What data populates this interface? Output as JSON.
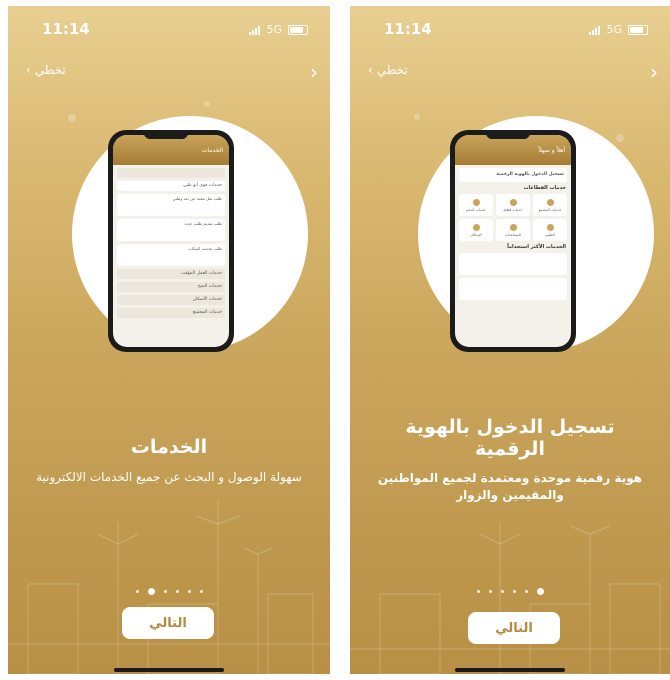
{
  "left": {
    "status": {
      "time": "11:14",
      "network": "5G"
    },
    "nav": {
      "skip": "تخطي",
      "skip_icon": "chevron-left-icon",
      "back_icon": "chevron-right-icon"
    },
    "mock_phone": {
      "header": "الخدمات",
      "rows": [
        "خدمات قوى أبو ظبي",
        "خدمات العمل المؤقت",
        "خدمات المنح",
        "خدمات الأسكان",
        "خدمات المجتمع"
      ],
      "cards": [
        "طلب نقل مقعد عن بعد وطني",
        "طلب تقديم طلب جديد",
        "طلب تحديث البيانات"
      ]
    },
    "title": "الخدمات",
    "subtitle": "سهولة الوصول و البحث عن جميع الخدمات الالكترونية",
    "pagination": {
      "count": 6,
      "active_index": 1
    },
    "next_label": "التالي"
  },
  "right": {
    "status": {
      "time": "11:14",
      "network": "5G"
    },
    "nav": {
      "skip": "تخطي",
      "skip_icon": "chevron-left-icon",
      "back_icon": "chevron-right-icon"
    },
    "mock_phone": {
      "header": "أهلاً و سهلاً",
      "login_text": "تسجيل الدخول بالهوية الرقمية",
      "sectors_title": "خدمات القطاعات",
      "tiles": [
        "خدمات الدعم",
        "خدمات قطاع",
        "خدمات المجتمع",
        "الإسكان",
        "المساعدات",
        "التعليم"
      ],
      "most_used_title": "الخدمات الأكثر استخداماً"
    },
    "title": "تسجيل الدخول بالهوية الرقمية",
    "subtitle": "هوية رقمية موحدة ومعتمدة لجميع المواطنين والمقيمين والزوار",
    "pagination": {
      "count": 6,
      "active_index": 5
    },
    "next_label": "التالي"
  }
}
